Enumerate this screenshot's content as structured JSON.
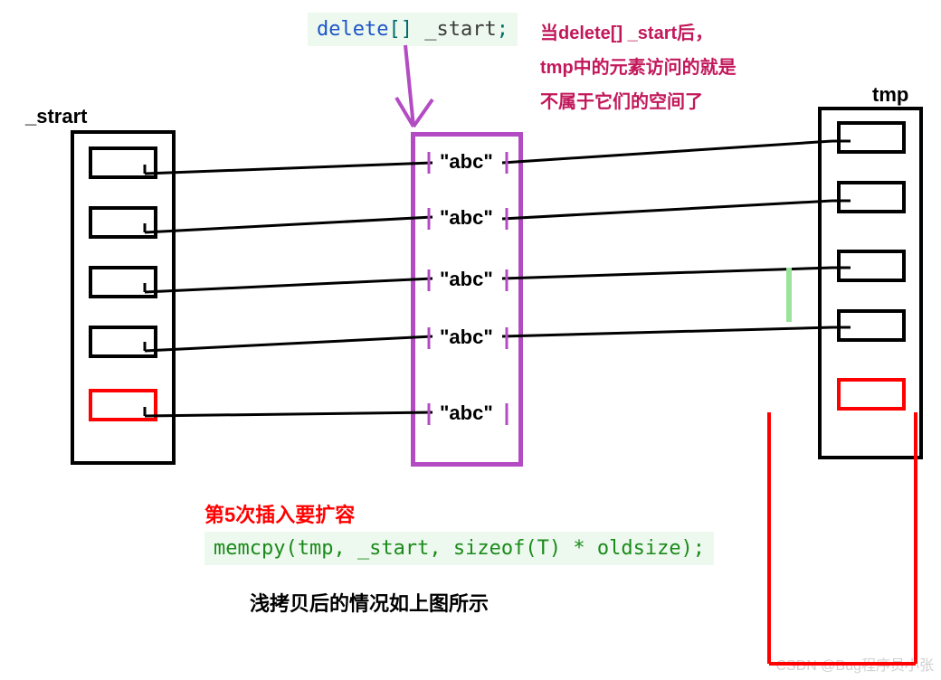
{
  "code_top": {
    "delete_kw": "delete",
    "brackets": "[] ",
    "var": "_start",
    "semi": ";"
  },
  "note_text": "当delete[] _start后，tmp中的元素访问的就是不属于它们的空间了",
  "labels": {
    "left": "_strart",
    "right": "tmp"
  },
  "abc": [
    "\"abc\"",
    "\"abc\"",
    "\"abc\"",
    "\"abc\"",
    "\"abc\""
  ],
  "caption_red": "第5次插入要扩容",
  "code_bottom": "memcpy(tmp, _start, sizeof(T) * oldsize);",
  "caption_black": "浅拷贝后的情况如上图所示",
  "watermark": "CSDN @Bug程序员小张"
}
